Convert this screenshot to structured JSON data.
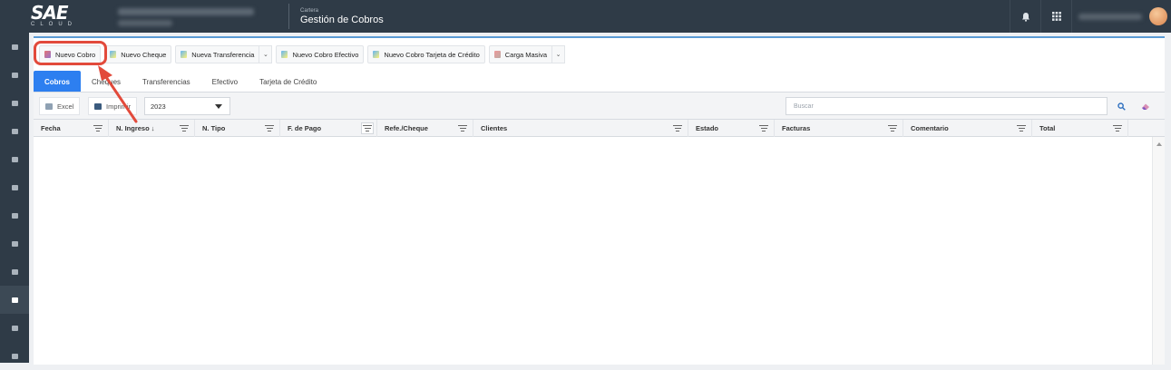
{
  "topbar": {
    "logo_main": "SAE",
    "logo_sub": "CLOUD",
    "module_parent": "Cartera",
    "module_title": "Gestión de Cobros",
    "bell_icon": "bell-icon",
    "apps_icon": "grid-icon"
  },
  "sidebar": {
    "items": [
      "menu-1",
      "menu-2",
      "menu-3",
      "menu-4",
      "menu-5",
      "menu-6",
      "menu-7",
      "menu-8",
      "menu-9",
      "menu-10",
      "menu-11",
      "menu-12"
    ]
  },
  "toolbar": {
    "nuevo_cobro": "Nuevo Cobro",
    "nuevo_cheque": "Nuevo Cheque",
    "nueva_transferencia": "Nueva Transferencia",
    "nuevo_cobro_efectivo": "Nuevo Cobro Efectivo",
    "nuevo_cobro_tarjeta": "Nuevo Cobro Tarjeta de Crédito",
    "carga_masiva": "Carga Masiva"
  },
  "tabs": [
    "Cobros",
    "Cheques",
    "Transferencias",
    "Efectivo",
    "Tarjeta de Crédito"
  ],
  "gridbar": {
    "excel": "Excel",
    "imprimir": "Imprimir",
    "year": "2023",
    "search_placeholder": "Buscar"
  },
  "columns": [
    "Fecha",
    "N. Ingreso ↓",
    "N. Tipo",
    "F. de Pago",
    "Refe./Cheque",
    "Clientes",
    "Estado",
    "Facturas",
    "Comentario",
    "Total"
  ],
  "colors": {
    "topbar": "#2f3b47",
    "accent": "#2d7ff0",
    "annotation": "#e24a3b"
  }
}
